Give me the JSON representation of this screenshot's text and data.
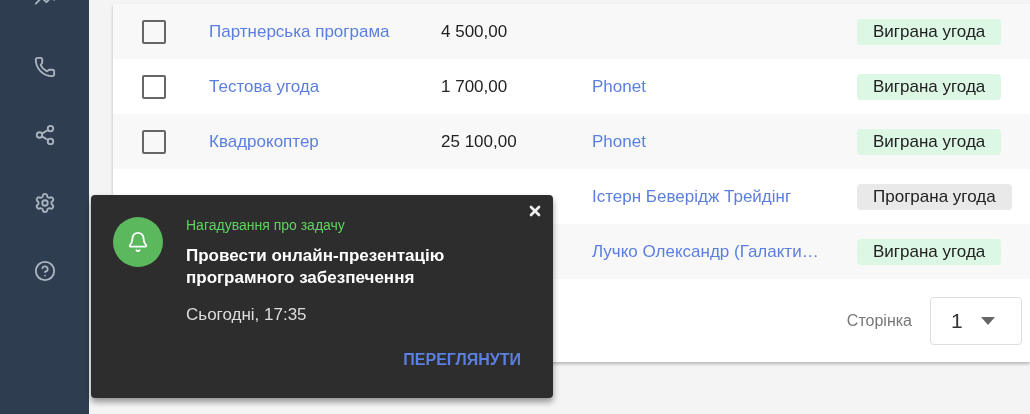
{
  "table": {
    "rows": [
      {
        "checked": false,
        "name": "Партнерська програма",
        "amount": "4 500,00",
        "status": {
          "label": "Виграна угода",
          "kind": "won"
        }
      },
      {
        "checked": false,
        "name": "Тестова угода",
        "amount": "1 700,00",
        "company": "Phonet",
        "status": {
          "label": "Виграна угода",
          "kind": "won"
        }
      },
      {
        "checked": false,
        "name": "Квадрокоптер",
        "amount": "25 100,00",
        "company": "Phonet",
        "status": {
          "label": "Виграна угода",
          "kind": "won"
        }
      },
      {
        "company": "Істерн Беверідж Трейдінг",
        "status": {
          "label": "Програна угода",
          "kind": "lost"
        }
      },
      {
        "company": "Лучко Олександр (Галакти…",
        "status": {
          "label": "Виграна угода",
          "kind": "won"
        }
      }
    ]
  },
  "pagination": {
    "label": "Сторінка",
    "value": "1"
  },
  "toast": {
    "category": "Нагадування про задачу",
    "title": "Провести онлайн-презентацію програмного забезпечення",
    "time": "Сьогодні, 17:35",
    "action": "ПЕРЕГЛЯНУТИ"
  }
}
